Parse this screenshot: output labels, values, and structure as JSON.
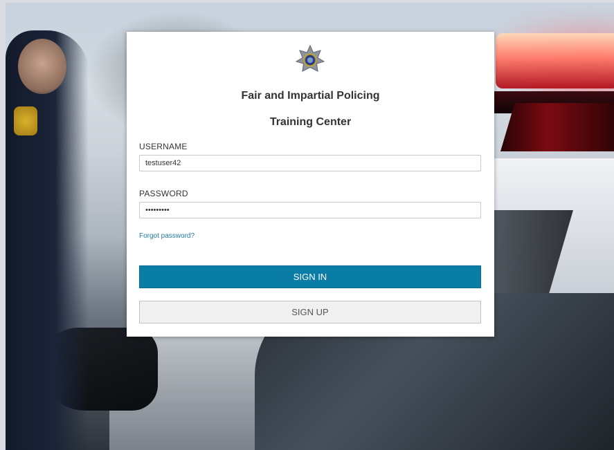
{
  "app": {
    "title_line1": "Fair and Impartial Policing",
    "title_line2": "Training Center",
    "logo_icon": "star-badge-icon"
  },
  "form": {
    "username_label": "USERNAME",
    "username_value": "testuser42",
    "password_label": "PASSWORD",
    "password_value": "•••••••••",
    "forgot_link": "Forgot password?"
  },
  "buttons": {
    "sign_in": "SIGN IN",
    "sign_up": "SIGN UP"
  },
  "colors": {
    "primary": "#0a7da6",
    "link": "#1f7aa0",
    "secondary_bg": "#f0f0f0"
  }
}
